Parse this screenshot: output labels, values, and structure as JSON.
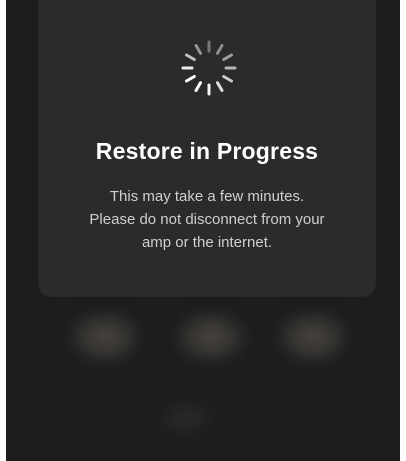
{
  "dialog": {
    "spinner_icon": "loading-spinner-icon",
    "title": "Restore in Progress",
    "message_lines": [
      "This may take a few minutes.",
      "Please do not disconnect from your",
      "amp or the internet."
    ]
  },
  "colors": {
    "background": "#1d1d1f",
    "dialog": "#2b2b2d",
    "title": "#ffffff",
    "message": "#cfcfd1"
  }
}
